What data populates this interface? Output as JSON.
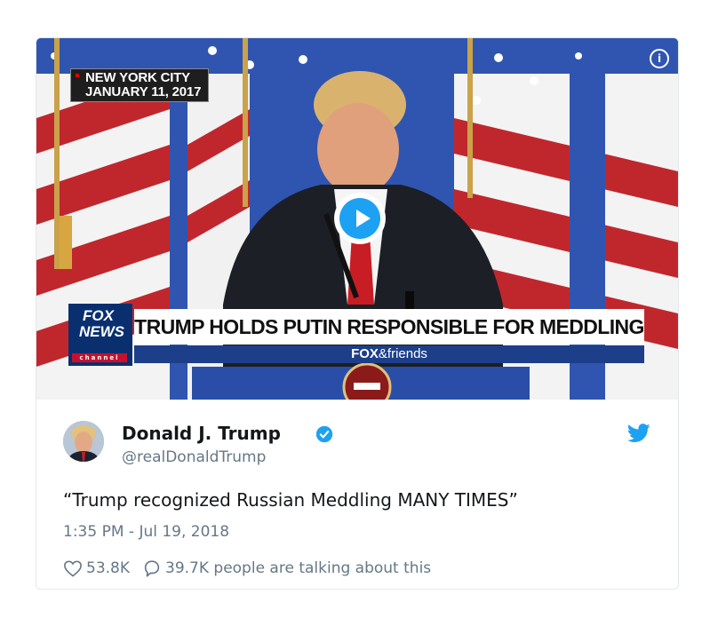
{
  "video": {
    "dateline_city": "NEW YORK CITY",
    "dateline_date": "JANUARY 11, 2017",
    "network_top": "FOX",
    "network_bottom": "NEWS",
    "network_channel": "channel",
    "headline": "TRUMP HOLDS PUTIN RESPONSIBLE FOR MEDDLING",
    "show_brand": "FOX",
    "show_suffix": "&friends",
    "info_label": "i"
  },
  "tweet": {
    "display_name": "Donald J. Trump",
    "handle": "@realDonaldTrump",
    "text": "“Trump recognized Russian Meddling MANY TIMES”",
    "timestamp": "1:35 PM - Jul 19, 2018",
    "likes": "53.8K",
    "replies_summary": "39.7K people are talking about this"
  },
  "colors": {
    "accent": "#1da1f2",
    "muted": "#657786",
    "text": "#14171a"
  }
}
